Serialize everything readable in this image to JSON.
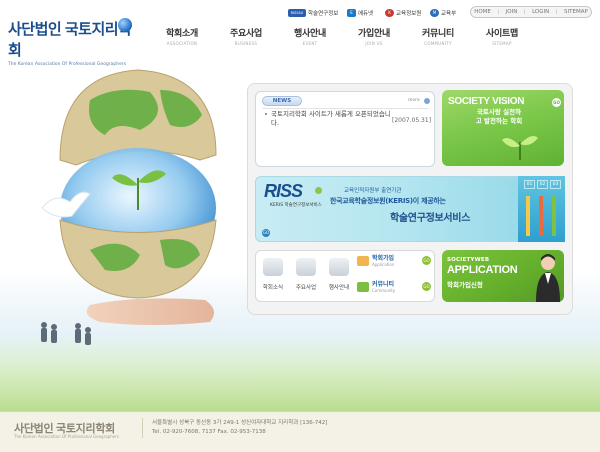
{
  "header": {
    "logo_ko": "사단법인 국토지리학회",
    "logo_en": "The Korean Association Of Professional Geographers",
    "util_links": [
      {
        "label": "학술연구정보",
        "badge": "RISS4U",
        "color": "#2a5fae"
      },
      {
        "label": "에듀넷",
        "badge": "E",
        "color": "#1a7ac4"
      },
      {
        "label": "교육정보원",
        "badge": "K",
        "color": "#c73a2f"
      },
      {
        "label": "교육부",
        "badge": "M",
        "color": "#2d6db8"
      }
    ],
    "top_nav": [
      "HOME",
      "JOIN",
      "LOGIN",
      "SITEMAP"
    ],
    "menu": [
      {
        "ko": "학회소개",
        "en": "ASSOCIATION"
      },
      {
        "ko": "주요사업",
        "en": "BUSINESS"
      },
      {
        "ko": "행사안내",
        "en": "EVENT"
      },
      {
        "ko": "가입안내",
        "en": "JOIN US"
      },
      {
        "ko": "커뮤니티",
        "en": "COMMUNITY"
      },
      {
        "ko": "사이트맵",
        "en": "SITEMAP"
      }
    ]
  },
  "news": {
    "tab": "NEWS",
    "more": "more",
    "title": "국토지리학회 사이트가 새롭게 오픈되었습니다.",
    "date": "[2007.05.31]"
  },
  "vision": {
    "title": "SOCIETY VISION",
    "sub": "국토사랑 실천하고 발전하는 학회"
  },
  "riss": {
    "logo": "RISS",
    "sub": "KERIS 학술연구정보서비스",
    "caption": "교육인적자원부 출연기관",
    "line2": "한국교육학술정보원(KERIS)이 제공하는",
    "line3": "학술연구정보서비스",
    "nums": [
      "01",
      "02",
      "03"
    ]
  },
  "quick": {
    "items": [
      "학회소식",
      "주요사업",
      "행사안내"
    ],
    "join_ko": "학회가입",
    "join_en": "Application",
    "community_ko": "커뮤니티",
    "community_en": "Community",
    "go": "GO"
  },
  "apply": {
    "society": "SOCIETYWEB",
    "title": "APPLICATION",
    "sub": "학회가입신청"
  },
  "footer": {
    "logo_ko": "사단법인 국토지리학회",
    "logo_en": "The Korean Association Of Professional Geographers",
    "address": "서울특별시 성북구 동선동 3가 249-1 성신여자대학교 지리학과 [136-742]",
    "contact": "Tel. 02-920-7608, 7137    Fax. 02-953-7138"
  },
  "colors": {
    "brand_blue": "#1b4d8c",
    "accent_green": "#7cc84a",
    "riss_blue": "#1e5a9a"
  }
}
